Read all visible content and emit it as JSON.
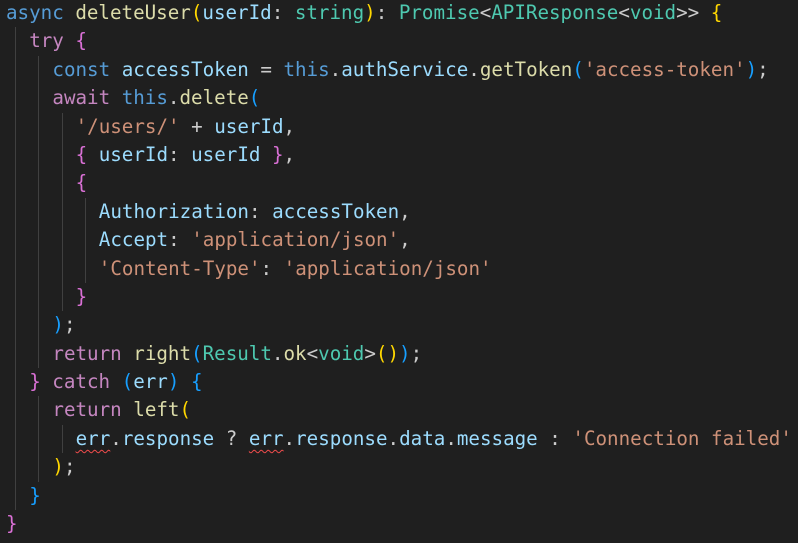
{
  "editor": {
    "language": "typescript",
    "theme_background": "#1f1f1f",
    "lines": [
      {
        "indent": 0,
        "tokens": [
          {
            "t": "async ",
            "c": "kw"
          },
          {
            "t": "deleteUser",
            "c": "fn"
          },
          {
            "t": "(",
            "c": "b1"
          },
          {
            "t": "userId",
            "c": "var"
          },
          {
            "t": ": ",
            "c": "punc"
          },
          {
            "t": "string",
            "c": "type"
          },
          {
            "t": ")",
            "c": "b1"
          },
          {
            "t": ": ",
            "c": "punc"
          },
          {
            "t": "Promise",
            "c": "type"
          },
          {
            "t": "<",
            "c": "punc"
          },
          {
            "t": "APIResponse",
            "c": "type"
          },
          {
            "t": "<",
            "c": "punc"
          },
          {
            "t": "void",
            "c": "type"
          },
          {
            "t": ">> ",
            "c": "punc"
          },
          {
            "t": "{",
            "c": "b1"
          }
        ]
      },
      {
        "indent": 1,
        "tokens": [
          {
            "t": "try ",
            "c": "ctl"
          },
          {
            "t": "{",
            "c": "b2"
          }
        ]
      },
      {
        "indent": 2,
        "tokens": [
          {
            "t": "const ",
            "c": "kw"
          },
          {
            "t": "accessToken",
            "c": "var"
          },
          {
            "t": " = ",
            "c": "punc"
          },
          {
            "t": "this",
            "c": "kw"
          },
          {
            "t": ".",
            "c": "punc"
          },
          {
            "t": "authService",
            "c": "var"
          },
          {
            "t": ".",
            "c": "punc"
          },
          {
            "t": "getToken",
            "c": "fn"
          },
          {
            "t": "(",
            "c": "b3"
          },
          {
            "t": "'access-token'",
            "c": "str"
          },
          {
            "t": ")",
            "c": "b3"
          },
          {
            "t": ";",
            "c": "punc"
          }
        ]
      },
      {
        "indent": 2,
        "tokens": [
          {
            "t": "await ",
            "c": "ctl"
          },
          {
            "t": "this",
            "c": "kw"
          },
          {
            "t": ".",
            "c": "punc"
          },
          {
            "t": "delete",
            "c": "fn"
          },
          {
            "t": "(",
            "c": "b3"
          }
        ]
      },
      {
        "indent": 3,
        "tokens": [
          {
            "t": "'/users/'",
            "c": "str"
          },
          {
            "t": " + ",
            "c": "punc"
          },
          {
            "t": "userId",
            "c": "var"
          },
          {
            "t": ",",
            "c": "punc"
          }
        ]
      },
      {
        "indent": 3,
        "tokens": [
          {
            "t": "{ ",
            "c": "b2"
          },
          {
            "t": "userId",
            "c": "var"
          },
          {
            "t": ": ",
            "c": "punc"
          },
          {
            "t": "userId",
            "c": "var"
          },
          {
            "t": " }",
            "c": "b2"
          },
          {
            "t": ",",
            "c": "punc"
          }
        ]
      },
      {
        "indent": 3,
        "tokens": [
          {
            "t": "{",
            "c": "b2"
          }
        ]
      },
      {
        "indent": 4,
        "tokens": [
          {
            "t": "Authorization",
            "c": "var"
          },
          {
            "t": ": ",
            "c": "punc"
          },
          {
            "t": "accessToken",
            "c": "var"
          },
          {
            "t": ",",
            "c": "punc"
          }
        ]
      },
      {
        "indent": 4,
        "tokens": [
          {
            "t": "Accept",
            "c": "var"
          },
          {
            "t": ": ",
            "c": "punc"
          },
          {
            "t": "'application/json'",
            "c": "str"
          },
          {
            "t": ",",
            "c": "punc"
          }
        ]
      },
      {
        "indent": 4,
        "tokens": [
          {
            "t": "'Content-Type'",
            "c": "str"
          },
          {
            "t": ": ",
            "c": "punc"
          },
          {
            "t": "'application/json'",
            "c": "str"
          }
        ]
      },
      {
        "indent": 3,
        "tokens": [
          {
            "t": "}",
            "c": "b2"
          }
        ]
      },
      {
        "indent": 2,
        "tokens": [
          {
            "t": ")",
            "c": "b3"
          },
          {
            "t": ";",
            "c": "punc"
          }
        ]
      },
      {
        "indent": 2,
        "tokens": [
          {
            "t": "return ",
            "c": "ctl"
          },
          {
            "t": "right",
            "c": "fn"
          },
          {
            "t": "(",
            "c": "b3"
          },
          {
            "t": "Result",
            "c": "type"
          },
          {
            "t": ".",
            "c": "punc"
          },
          {
            "t": "ok",
            "c": "fn"
          },
          {
            "t": "<",
            "c": "punc"
          },
          {
            "t": "void",
            "c": "type"
          },
          {
            "t": ">",
            "c": "punc"
          },
          {
            "t": "()",
            "c": "b1"
          },
          {
            "t": ")",
            "c": "b3"
          },
          {
            "t": ";",
            "c": "punc"
          }
        ]
      },
      {
        "indent": 1,
        "tokens": [
          {
            "t": "}",
            "c": "b2"
          },
          {
            "t": " catch ",
            "c": "ctl"
          },
          {
            "t": "(",
            "c": "b3"
          },
          {
            "t": "err",
            "c": "var"
          },
          {
            "t": ") ",
            "c": "b3"
          },
          {
            "t": "{",
            "c": "b3"
          }
        ]
      },
      {
        "indent": 2,
        "tokens": [
          {
            "t": "return ",
            "c": "ctl"
          },
          {
            "t": "left",
            "c": "fn"
          },
          {
            "t": "(",
            "c": "b1"
          }
        ]
      },
      {
        "indent": 3,
        "tokens": [
          {
            "t": "err",
            "c": "var",
            "err": true
          },
          {
            "t": ".",
            "c": "punc"
          },
          {
            "t": "response",
            "c": "var"
          },
          {
            "t": " ? ",
            "c": "punc"
          },
          {
            "t": "err",
            "c": "var",
            "err": true
          },
          {
            "t": ".",
            "c": "punc"
          },
          {
            "t": "response",
            "c": "var"
          },
          {
            "t": ".",
            "c": "punc"
          },
          {
            "t": "data",
            "c": "var"
          },
          {
            "t": ".",
            "c": "punc"
          },
          {
            "t": "message",
            "c": "var"
          },
          {
            "t": " : ",
            "c": "punc"
          },
          {
            "t": "'Connection failed'",
            "c": "str"
          }
        ]
      },
      {
        "indent": 2,
        "tokens": [
          {
            "t": ")",
            "c": "b1"
          },
          {
            "t": ";",
            "c": "punc"
          }
        ]
      },
      {
        "indent": 1,
        "tokens": [
          {
            "t": "}",
            "c": "b3"
          }
        ]
      },
      {
        "indent": 0,
        "tokens": [
          {
            "t": "}",
            "c": "b2"
          }
        ]
      }
    ]
  }
}
